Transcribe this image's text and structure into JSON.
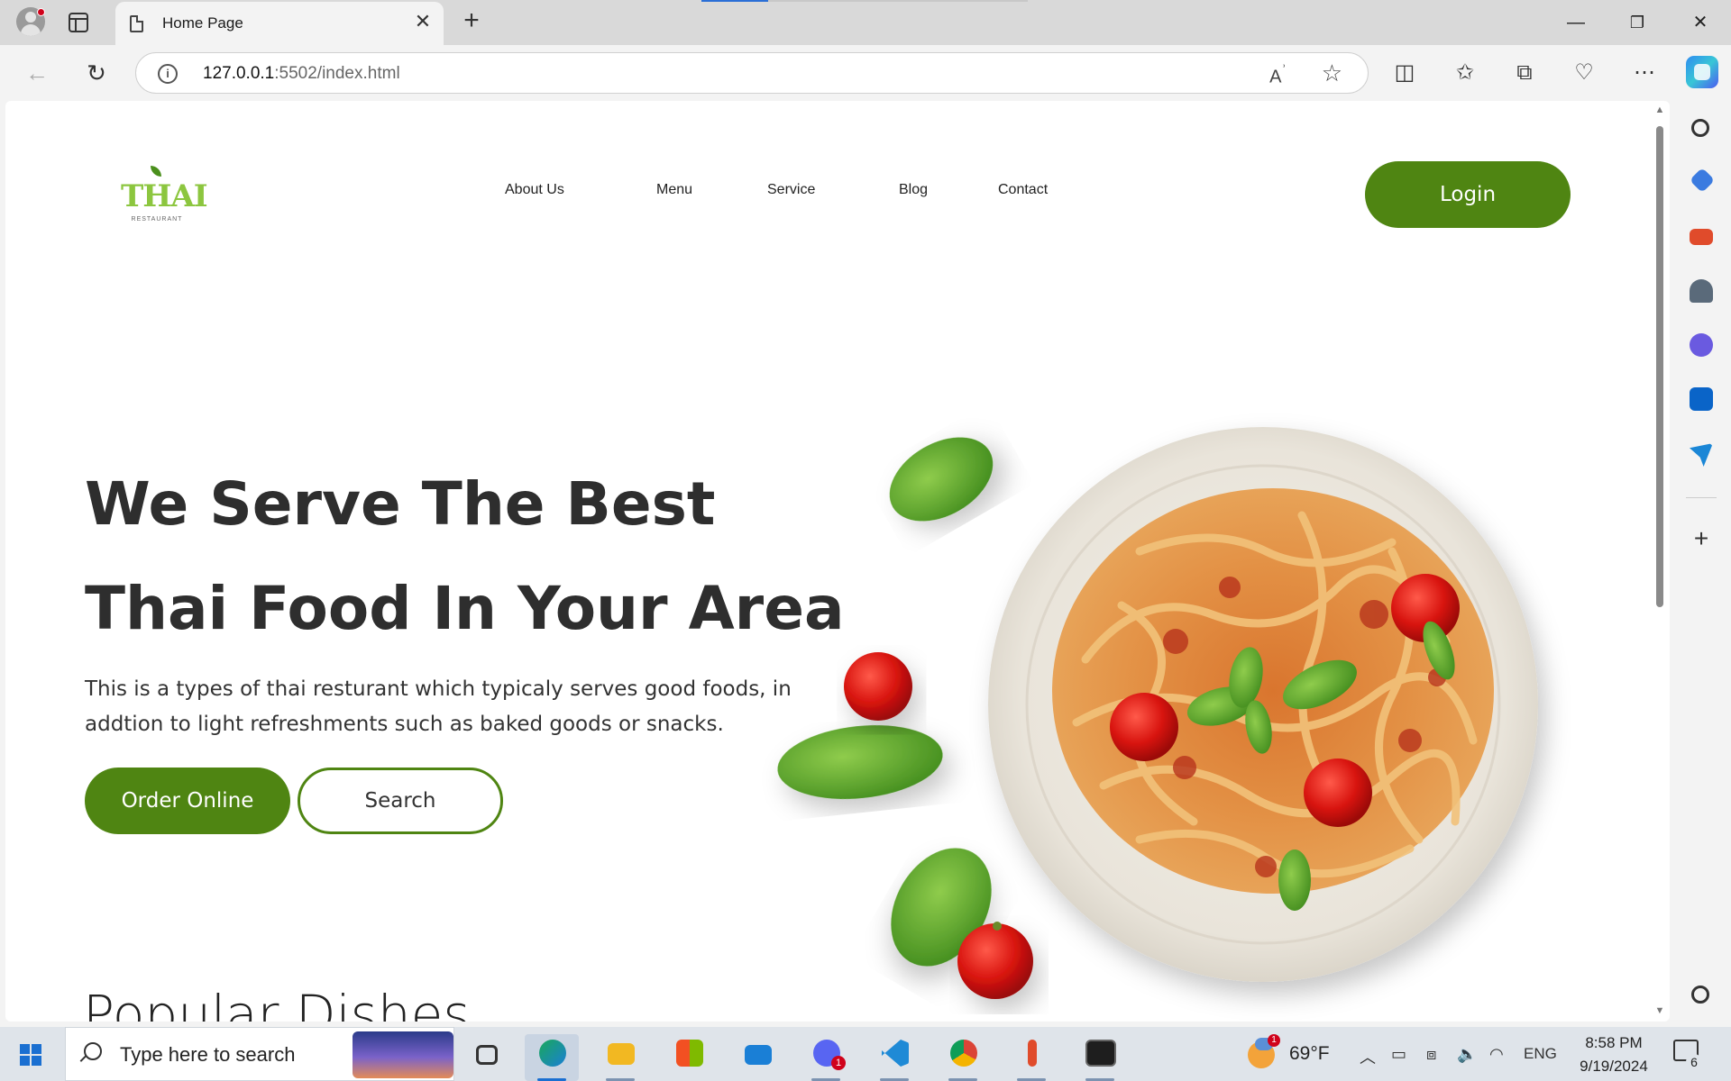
{
  "browser": {
    "tab_title": "Home Page",
    "tab_close": "✕",
    "new_tab": "+",
    "url_host": "127.0.0.1",
    "url_rest": ":5502/index.html",
    "read_aloud": "Aʬ",
    "window": {
      "minimize": "—",
      "restore": "❐",
      "close": "✕"
    },
    "toolbar_icons": [
      "split-screen-icon",
      "favorites-icon",
      "collections-icon",
      "browser-essentials-icon",
      "more-icon"
    ]
  },
  "site": {
    "logo_word": "THAI",
    "logo_tag": "RESTAURANT",
    "nav": [
      {
        "label": "About Us",
        "active": false
      },
      {
        "label": "Menu",
        "active": true
      },
      {
        "label": "Service",
        "active": false
      },
      {
        "label": "Blog",
        "active": false
      },
      {
        "label": "Contact",
        "active": false
      }
    ],
    "login_label": "Login",
    "hero_line1": "We Serve The Best",
    "hero_line2": "Thai Food In Your Area",
    "hero_desc": "This is a types of thai resturant which typicaly serves good foods, in addtion to light refreshments such as baked goods or snacks.",
    "order_label": "Order Online",
    "search_label": "Search",
    "section_title": "Popular Dishes",
    "colors": {
      "brand_green": "#4f8512",
      "nav_active": "#5a8a1a",
      "logo_green": "#8cc63f"
    }
  },
  "taskbar": {
    "search_placeholder": "Type here to search",
    "weather_badge": "1",
    "temperature": "69°F",
    "language": "ENG",
    "time": "8:58 PM",
    "date": "9/19/2024",
    "discord_badge": "1",
    "notifications_count": "6",
    "apps": [
      "task-view-icon",
      "edge-icon",
      "file-explorer-icon",
      "store-icon",
      "mail-icon",
      "discord-icon",
      "vscode-icon",
      "chrome-icon",
      "snipping-tool-icon",
      "terminal-icon"
    ]
  }
}
